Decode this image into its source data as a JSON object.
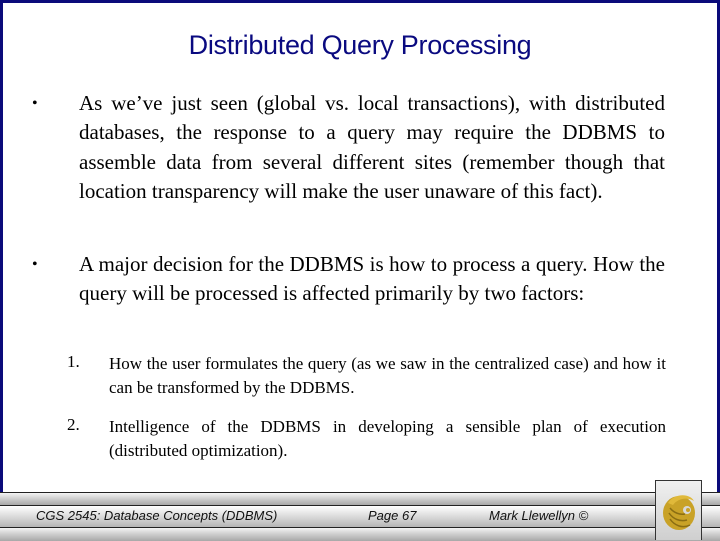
{
  "slide": {
    "title": "Distributed Query Processing",
    "bullets": [
      {
        "marker": "•",
        "text": "As we’ve just seen (global vs. local transactions), with distributed databases, the response to a query may require the DDBMS to assemble data from several different sites (remember though that location transparency will make the user unaware of this fact)."
      },
      {
        "marker": "•",
        "text": "A major decision for the DDBMS is how to process a query. How the query will be processed is affected primarily by two factors:"
      }
    ],
    "numbered_items": [
      {
        "number": "1.",
        "text": "How the user formulates the query (as we saw in the centralized case) and how it can be transformed by the DDBMS."
      },
      {
        "number": "2.",
        "text": "Intelligence of the DDBMS in developing a sensible plan of execution (distributed optimization)."
      }
    ]
  },
  "footer": {
    "course": "CGS 2545: Database Concepts  (DDBMS)",
    "page": "Page 67",
    "author": "Mark Llewellyn ©",
    "logo_icon": "pegasus-logo-icon"
  },
  "colors": {
    "title": "#0a0a80",
    "border": "#0a0a7a",
    "logo_gold": "#c9a227"
  }
}
